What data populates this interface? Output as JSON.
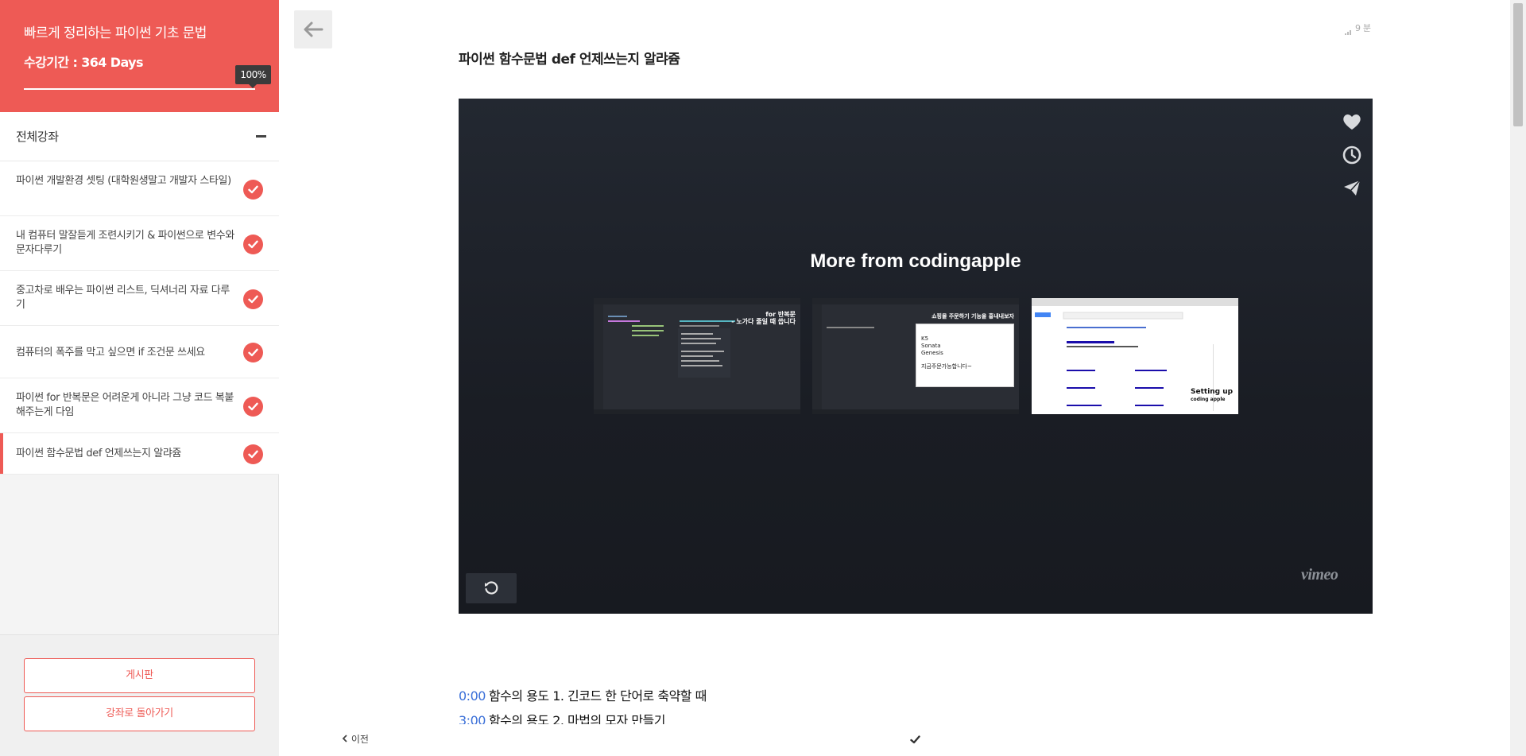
{
  "course": {
    "title": "빠르게 정리하는 파이썬 기초 문법",
    "period": "수강기간 : 364 Days",
    "progress_percent": 100,
    "progress_label": "100%"
  },
  "curriculum": {
    "header": "전체강좌",
    "lectures": [
      {
        "title": "파이썬 개발환경 셋팅 (대학원생말고 개발자 스타일)",
        "completed": true
      },
      {
        "title": "내 컴퓨터 말잘듣게 조련시키기 & 파이썬으로 변수와 문자다루기",
        "completed": true
      },
      {
        "title": "중고차로 배우는 파이썬 리스트, 딕셔너리 자료 다루기",
        "completed": true
      },
      {
        "title": "컴퓨터의 폭주를 막고 싶으면 if 조건문 쓰세요",
        "completed": true
      },
      {
        "title": "파이썬 for 반복문은 어려운게 아니라 그냥 코드 복붙해주는게 다임",
        "completed": true
      },
      {
        "title": "파이썬 함수문법 def 언제쓰는지 알랴쥼",
        "completed": true,
        "active": true
      }
    ]
  },
  "footer": {
    "board_button": "게시판",
    "back_to_course_button": "강좌로 돌아가기"
  },
  "lesson": {
    "read_time": "9 분",
    "title": "파이썬 함수문법 def 언제쓰는지 알랴쥼"
  },
  "player": {
    "heading": "More from codingapple",
    "thumbnails": [
      {
        "caption": "for 반복문",
        "subcaption": "- 노가다 줄일 때 씁니다"
      },
      {
        "caption": "쇼핑몰 주문하기 기능을 흉내내보자",
        "items": [
          "K5",
          "Sonata",
          "Genesis"
        ],
        "note": "지금주문가능합니다~"
      },
      {
        "caption": "Setting up",
        "subcaption": "coding apple"
      }
    ],
    "brand": "vimeo",
    "accent_color": "#ee5a55"
  },
  "timestamps": [
    {
      "time": "0:00",
      "text": "함수의 용도 1. 긴코드 한 단어로 축약할 때"
    },
    {
      "time": "3:00",
      "text": "함수의 용도 2. 마법의 모자 만들기"
    }
  ],
  "nav": {
    "prev_label": "이전"
  }
}
